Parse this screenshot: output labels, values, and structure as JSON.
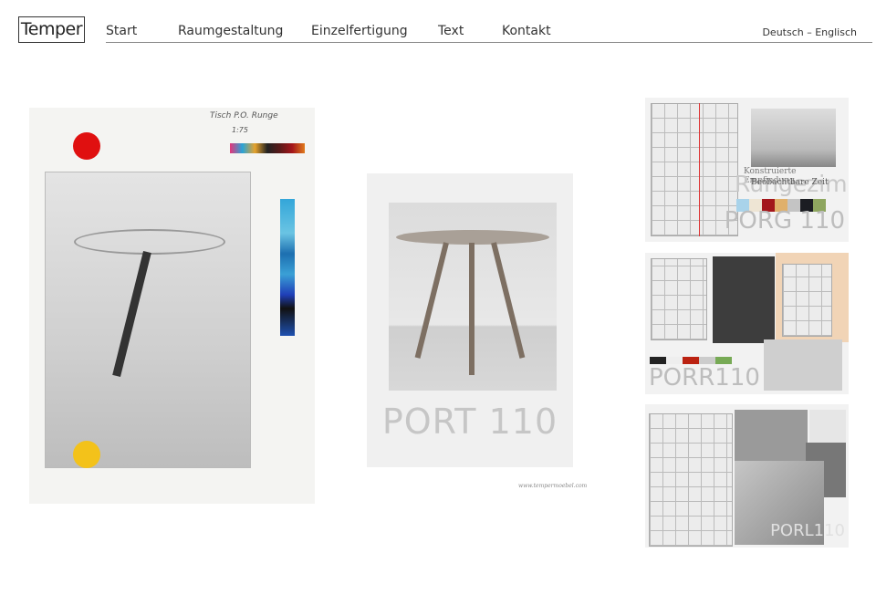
{
  "logo": "Temper",
  "nav": [
    {
      "label": "Start"
    },
    {
      "label": "Raumgestaltung"
    },
    {
      "label": "Einzelfertigung"
    },
    {
      "label": "Text"
    },
    {
      "label": "Kontakt"
    }
  ],
  "lang": "Deutsch – Englisch",
  "drawing": {
    "title": "Tisch P.O. Runge",
    "scale": "1:75"
  },
  "center": {
    "label": "PORT 110",
    "url": "www.tempermoebel.com"
  },
  "thumbs": [
    {
      "label": "PORG 110",
      "subtitle1": "Konstruierte Empfindung",
      "subtitle2": "Beobachtbare Zeit",
      "overlay": "Rungezimmer",
      "swatches": [
        "#a9d3ea",
        "#eee5d4",
        "#a3161b",
        "#e0b06b",
        "#c4c4c4",
        "#1b1d22",
        "#8ea65f"
      ]
    },
    {
      "label": "PORR110"
    },
    {
      "label": "PORL110"
    }
  ]
}
